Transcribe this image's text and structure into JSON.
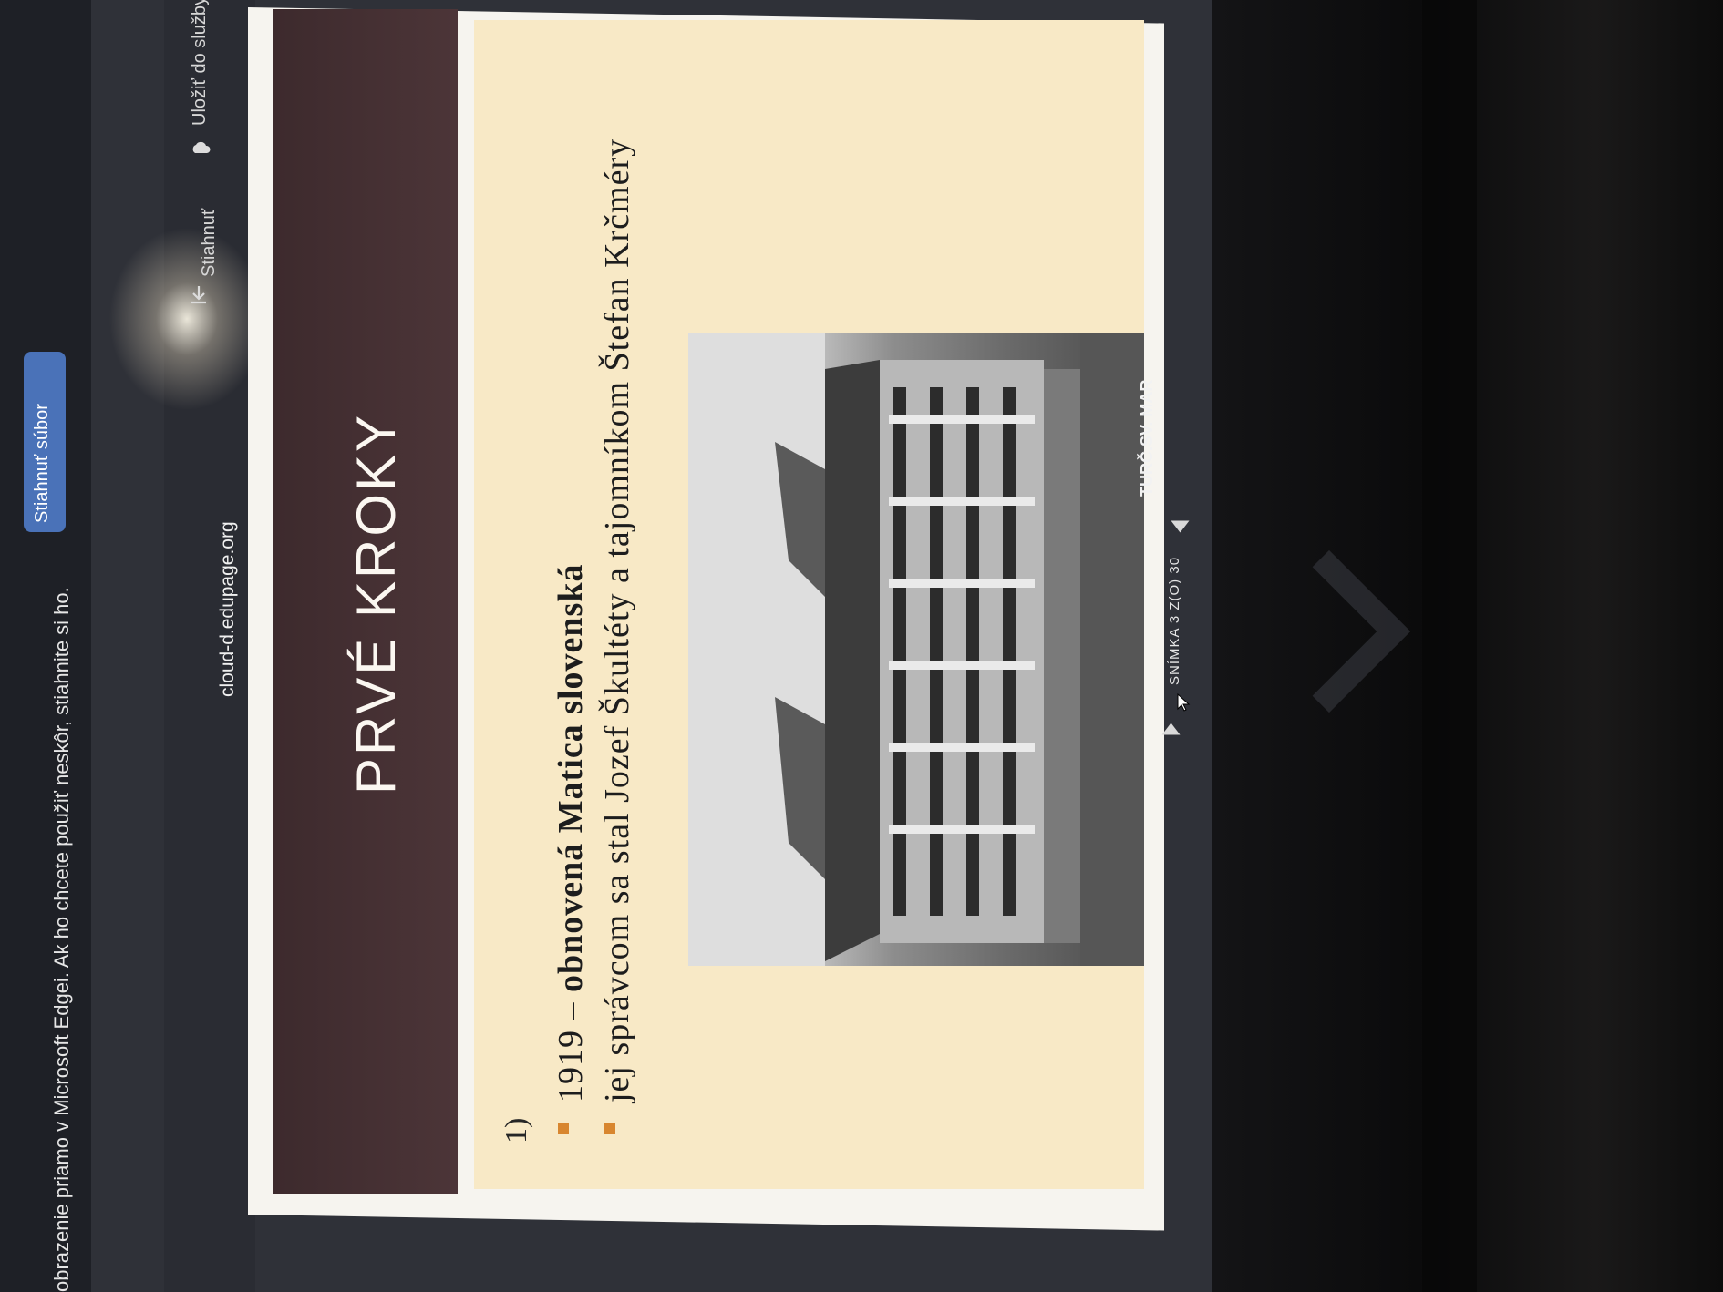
{
  "notification_bar": {
    "message": "obrazenie priamo v Microsoft Edgei. Ak ho chcete použiť neskôr, stiahnite si ho.",
    "download_button": "Stiahnuť súbor"
  },
  "toolbar": {
    "domain": "cloud-d.edupage.org",
    "download_label": "Stiahnuť",
    "download_icon": "download-icon",
    "save_label": "Uložiť do služby",
    "save_icon": "cloud-icon"
  },
  "slide": {
    "title": "PRVÉ KROKY",
    "number_label": "1)",
    "bullets": [
      {
        "year": "1919",
        "dash": " – ",
        "text": "obnovená Matica slovenská"
      },
      {
        "text": "jej správcom sa stal Jozef Škultéty a tajomníkom Štefan Krčméry"
      }
    ],
    "photo_caption": "TURČ.SV. MAR",
    "colors": {
      "title_bar": "#4c3538",
      "body_background": "#f8e9c6",
      "bullet": "#d8862f"
    }
  },
  "navigation": {
    "counter": "SNÍMKA 3 Z(O) 30",
    "prev_icon": "prev-arrow-icon",
    "next_icon": "next-arrow-icon"
  }
}
